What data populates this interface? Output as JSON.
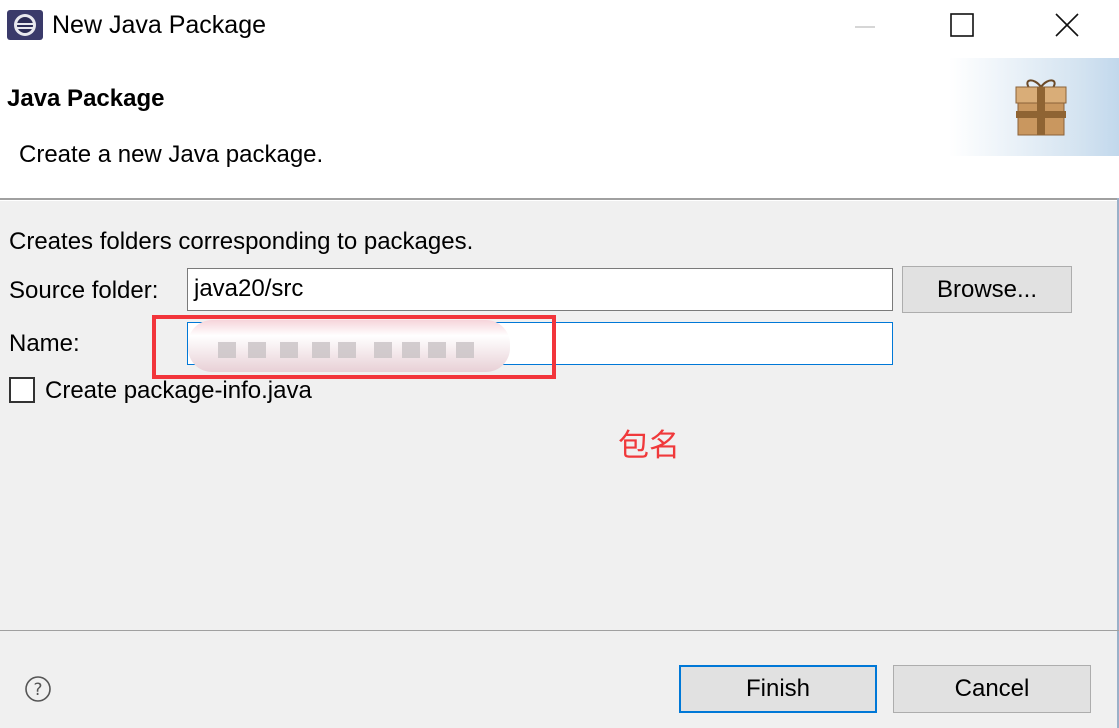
{
  "window": {
    "title": "New Java Package",
    "icons": {
      "app": "eclipse-icon",
      "minimize": "minimize-icon",
      "maximize": "maximize-icon",
      "close": "close-icon"
    }
  },
  "header": {
    "title": "Java Package",
    "description": "Create a new Java package.",
    "icon": "package-icon"
  },
  "form": {
    "info_text": "Creates folders corresponding to packages.",
    "source_folder_label": "Source folder:",
    "source_folder_value": "java20/src",
    "browse_label": "Browse...",
    "name_label": "Name:",
    "name_value": "",
    "checkbox_label": "Create package-info.java",
    "checkbox_checked": false
  },
  "annotation": {
    "text": "包名",
    "color": "#f0393b"
  },
  "footer": {
    "help_icon": "help-icon",
    "finish_label": "Finish",
    "cancel_label": "Cancel"
  },
  "colors": {
    "accent": "#0078d7",
    "highlight": "#f2353b"
  }
}
